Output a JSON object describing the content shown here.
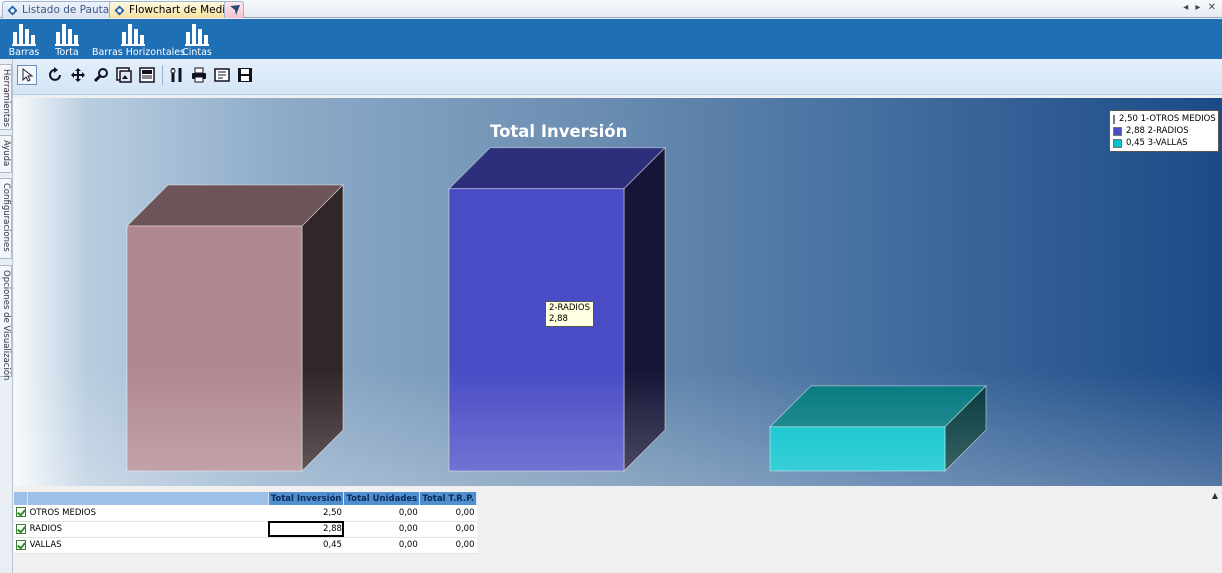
{
  "tabs": [
    {
      "label": "Listado de Pautas"
    },
    {
      "label": "Flowchart de Medios"
    }
  ],
  "ribbon": {
    "buttons": [
      {
        "label": "Barras"
      },
      {
        "label": "Torta"
      },
      {
        "label": "Barras Horizontales"
      },
      {
        "label": "Cintas"
      }
    ]
  },
  "side_tabs": [
    {
      "label": "Herramientas"
    },
    {
      "label": "Ayuda"
    },
    {
      "label": "Configuraciones"
    },
    {
      "label": "Opciones de Visualización"
    }
  ],
  "chart_data": {
    "type": "bar",
    "title": "Total Inversión",
    "categories": [
      "1-OTROS MEDIOS",
      "2-RADIOS",
      "3-VALLAS"
    ],
    "values": [
      2.5,
      2.88,
      0.45
    ],
    "colors": [
      "#b08890",
      "#4a4cc6",
      "#00c2cc"
    ],
    "legend": {
      "position": "top-right",
      "entries": [
        "2,50 1-OTROS MEDIOS",
        "2,88 2-RADIOS",
        "0,45 3-VALLAS"
      ]
    },
    "tooltip": {
      "line1": "2-RADIOS",
      "line2": "2,88"
    }
  },
  "grid": {
    "headers": [
      "Total Inversión",
      "Total Unidades",
      "Total T.R.P."
    ],
    "rows": [
      {
        "name": "OTROS MEDIOS",
        "inversion": "2,50",
        "unidades": "0,00",
        "trp": "0,00"
      },
      {
        "name": "RADIOS",
        "inversion": "2,88",
        "unidades": "0,00",
        "trp": "0,00"
      },
      {
        "name": "VALLAS",
        "inversion": "0,45",
        "unidades": "0,00",
        "trp": "0,00"
      }
    ]
  }
}
